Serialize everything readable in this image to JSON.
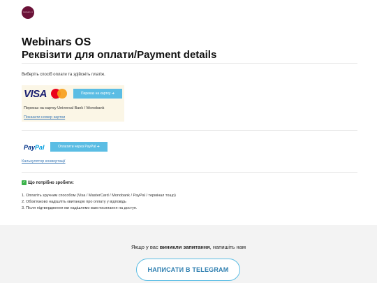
{
  "header": {
    "logo_text": "WEBINARS OS",
    "title": "Webinars OS",
    "subtitle": "Реквізити для оплати/Payment details"
  },
  "payment": {
    "lead": "Виберіть спосіб оплати та здійсніть платіж.",
    "card": {
      "visa_label": "VISA",
      "mastercard_caption": "mastercard",
      "button_label": "Переказ на картку ➔",
      "note": "Переказ на картку Universal Bank / Monobank",
      "link": "Показати номер картки"
    },
    "paypal": {
      "logo_part1": "Pay",
      "logo_part2": "Pal",
      "button_label": "Оплатити через PayPal ➔",
      "link": "Калькулятор конвертації"
    }
  },
  "todo": {
    "check_icon": "✓",
    "title": "Що потрібно зробити:",
    "steps": [
      "1. Оплатіть зручним способом (Visa / MasterCard / Monobank / PayPal / термінал тощо)",
      "2. Обов'язково надішліть квитанцію про оплату у відповідь",
      "3. Після підтвердження ми надішлемо вам посилання на доступ."
    ]
  },
  "footer": {
    "text_before": "Якщо у вас ",
    "text_bold": "виникли запитання",
    "text_after": ", напишіть нам",
    "button_label": "НАПИСАТИ В TELEGRAM"
  },
  "colors": {
    "accent": "#5bbde4",
    "link": "#3a78b5",
    "brand": "#6b1238"
  }
}
